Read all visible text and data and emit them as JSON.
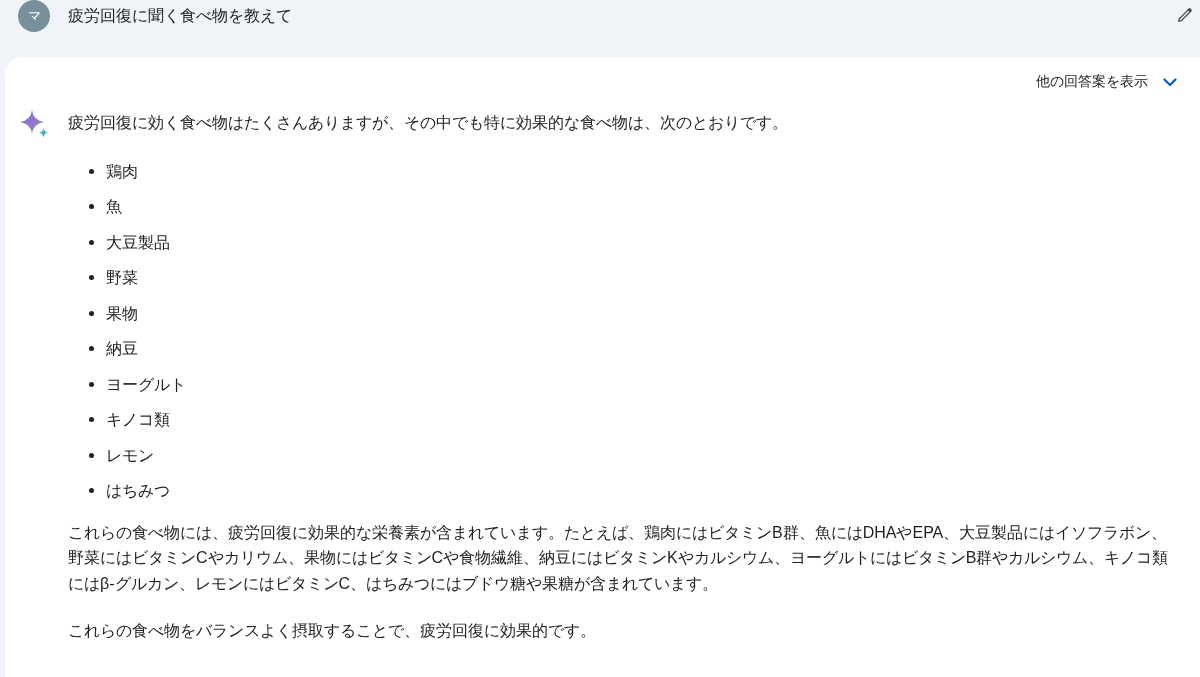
{
  "query": {
    "avatar_letter": "マ",
    "text": "疲労回復に聞く食べ物を教えて"
  },
  "response": {
    "drafts_toggle": {
      "label": "他の回答案を表示",
      "expanded": false
    },
    "intro": "疲労回復に効く食べ物はたくさんありますが、その中でも特に効果的な食べ物は、次のとおりです。",
    "bullets": [
      "鶏肉",
      "魚",
      "大豆製品",
      "野菜",
      "果物",
      "納豆",
      "ヨーグルト",
      "キノコ類",
      "レモン",
      "はちみつ"
    ],
    "paragraphs": [
      "これらの食べ物には、疲労回復に効果的な栄養素が含まれています。たとえば、鶏肉にはビタミンB群、魚にはDHAやEPA、大豆製品にはイソフラボン、野菜にはビタミンCやカリウム、果物にはビタミンCや食物繊維、納豆にはビタミンKやカルシウム、ヨーグルトにはビタミンB群やカルシウム、キノコ類にはβ-グルカン、レモンにはビタミンC、はちみつにはブドウ糖や果糖が含まれています。",
      "これらの食べ物をバランスよく摂取することで、疲労回復に効果的です。"
    ]
  }
}
